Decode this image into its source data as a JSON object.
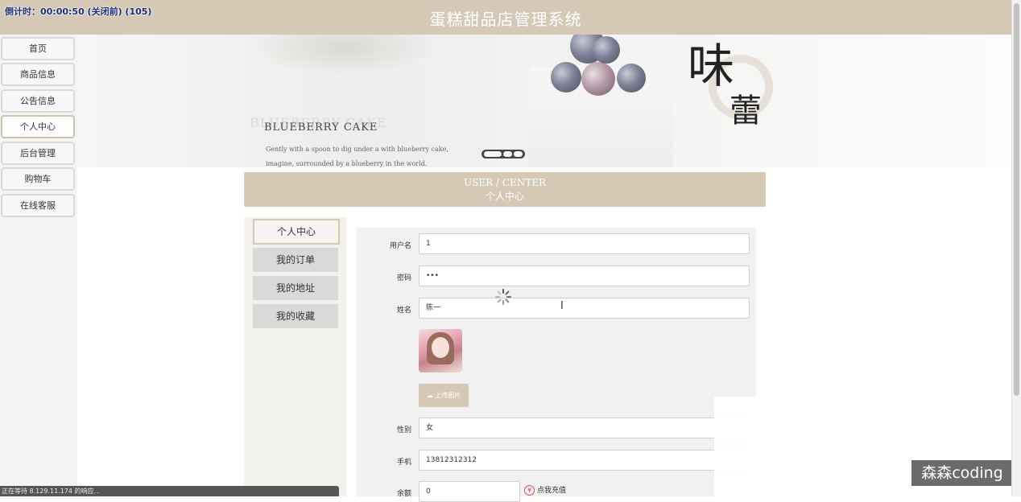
{
  "header": {
    "title": "蛋糕甜品店管理系统",
    "countdown": "倒计时：00:00:50 (关闭前) (105)"
  },
  "nav": {
    "items": [
      {
        "label": "首页"
      },
      {
        "label": "商品信息"
      },
      {
        "label": "公告信息"
      },
      {
        "label": "个人中心",
        "active": true
      },
      {
        "label": "后台管理"
      },
      {
        "label": "购物车"
      },
      {
        "label": "在线客服"
      }
    ]
  },
  "banner": {
    "ghost_text": "BLUEBERRY CAKE",
    "title": "BLUEBERRY CAKE",
    "tagline_1": "Gently with a spoon to dig under a with blueberry cake,",
    "tagline_2": "imagine, surrounded by a blueberry in the world.",
    "big_char_1": "味",
    "big_char_2": "蕾"
  },
  "section": {
    "title_en": "USER / CENTER",
    "title_cn": "个人中心"
  },
  "submenu": {
    "items": [
      {
        "label": "个人中心",
        "active": true
      },
      {
        "label": "我的订单"
      },
      {
        "label": "我的地址"
      },
      {
        "label": "我的收藏"
      }
    ]
  },
  "form": {
    "username_label": "用户名",
    "username_value": "1",
    "password_label": "密码",
    "password_value": "•••",
    "name_label": "姓名",
    "name_value": "陈一",
    "upload_label": "上传图片",
    "gender_label": "性别",
    "gender_value": "女",
    "phone_label": "手机",
    "phone_value": "13812312312",
    "balance_label": "余额",
    "balance_value": "0",
    "recharge_label": "点我充值",
    "recharge_icon": "¥"
  },
  "status": {
    "text": "正在等待 8.129.11.174 的响应..."
  },
  "watermark": {
    "text": "森森coding"
  },
  "colors": {
    "accent": "#d5c9b5",
    "submenu_bg": "#f3f1ec",
    "panel_bg": "#f1f1f1"
  }
}
